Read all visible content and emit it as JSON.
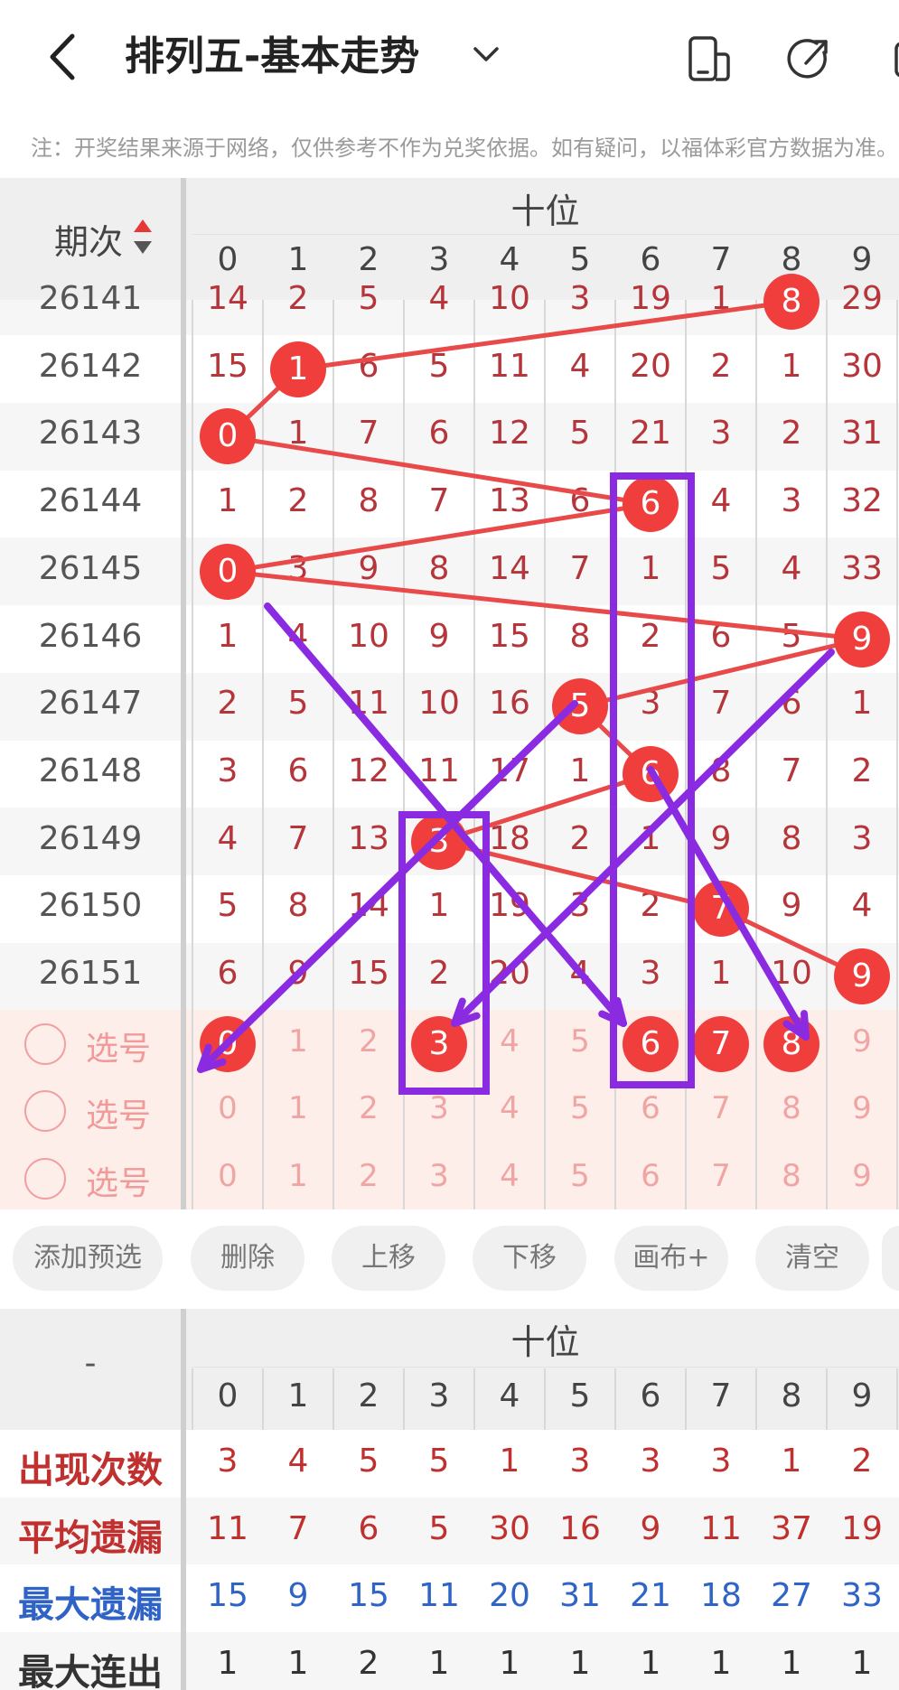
{
  "header": {
    "title": "排列五-基本走势",
    "notice": "注：开奖结果来源于网络，仅供参考不作为兑奖依据。如有疑问，以福体彩官方数据为准。"
  },
  "table": {
    "group_label": "十位",
    "period_label": "期次",
    "digits": [
      "0",
      "1",
      "2",
      "3",
      "4",
      "5",
      "6",
      "7",
      "8",
      "9"
    ],
    "rows": [
      {
        "period": "26141",
        "cells": [
          "14",
          "2",
          "5",
          "4",
          "10",
          "3",
          "19",
          "1",
          "8",
          "29"
        ],
        "hit": 8
      },
      {
        "period": "26142",
        "cells": [
          "15",
          "1",
          "6",
          "5",
          "11",
          "4",
          "20",
          "2",
          "1",
          "30"
        ],
        "hit": 1
      },
      {
        "period": "26143",
        "cells": [
          "0",
          "1",
          "7",
          "6",
          "12",
          "5",
          "21",
          "3",
          "2",
          "31"
        ],
        "hit": 0
      },
      {
        "period": "26144",
        "cells": [
          "1",
          "2",
          "8",
          "7",
          "13",
          "6",
          "6",
          "4",
          "3",
          "32"
        ],
        "hit": 6
      },
      {
        "period": "26145",
        "cells": [
          "0",
          "3",
          "9",
          "8",
          "14",
          "7",
          "1",
          "5",
          "4",
          "33"
        ],
        "hit": 0
      },
      {
        "period": "26146",
        "cells": [
          "1",
          "4",
          "10",
          "9",
          "15",
          "8",
          "2",
          "6",
          "5",
          "9"
        ],
        "hit": 9
      },
      {
        "period": "26147",
        "cells": [
          "2",
          "5",
          "11",
          "10",
          "16",
          "5",
          "3",
          "7",
          "6",
          "1"
        ],
        "hit": 5
      },
      {
        "period": "26148",
        "cells": [
          "3",
          "6",
          "12",
          "11",
          "17",
          "1",
          "6",
          "8",
          "7",
          "2"
        ],
        "hit": 6
      },
      {
        "period": "26149",
        "cells": [
          "4",
          "7",
          "13",
          "3",
          "18",
          "2",
          "1",
          "9",
          "8",
          "3"
        ],
        "hit": 3
      },
      {
        "period": "26150",
        "cells": [
          "5",
          "8",
          "14",
          "1",
          "19",
          "3",
          "2",
          "7",
          "9",
          "4"
        ],
        "hit": 7
      },
      {
        "period": "26151",
        "cells": [
          "6",
          "9",
          "15",
          "2",
          "20",
          "4",
          "3",
          "1",
          "10",
          "9"
        ],
        "hit": 9
      }
    ],
    "pick_label": "选号",
    "pick_rows": [
      {
        "selected": [
          0,
          3,
          6,
          7,
          8
        ]
      },
      {
        "selected": []
      },
      {
        "selected": []
      }
    ]
  },
  "actions": [
    "添加预选",
    "删除",
    "上移",
    "下移",
    "画布+",
    "清空"
  ],
  "stats": {
    "corner": "-",
    "group_label": "十位",
    "rows": [
      {
        "label": "出现次数",
        "color": "#c0302f",
        "values": [
          "3",
          "4",
          "5",
          "5",
          "1",
          "3",
          "3",
          "3",
          "1",
          "2"
        ]
      },
      {
        "label": "平均遗漏",
        "color": "#c0302f",
        "values": [
          "11",
          "7",
          "6",
          "5",
          "30",
          "16",
          "9",
          "11",
          "37",
          "19"
        ]
      },
      {
        "label": "最大遗漏",
        "color": "#2f63c6",
        "values": [
          "15",
          "9",
          "15",
          "11",
          "20",
          "31",
          "21",
          "18",
          "27",
          "33"
        ]
      },
      {
        "label": "最大连出",
        "color": "#333333",
        "values": [
          "1",
          "1",
          "2",
          "1",
          "1",
          "1",
          "1",
          "1",
          "1",
          "1"
        ]
      }
    ]
  },
  "colors": {
    "ball": "#ef3e3c",
    "line": "#e84a4a",
    "annotation": "#8a2be2",
    "pickbg": "#fdeeea"
  },
  "icons": [
    "back-arrow-icon",
    "chevron-down-icon",
    "phone-icon",
    "share-icon",
    "more-icon",
    "sort-arrows-icon"
  ]
}
